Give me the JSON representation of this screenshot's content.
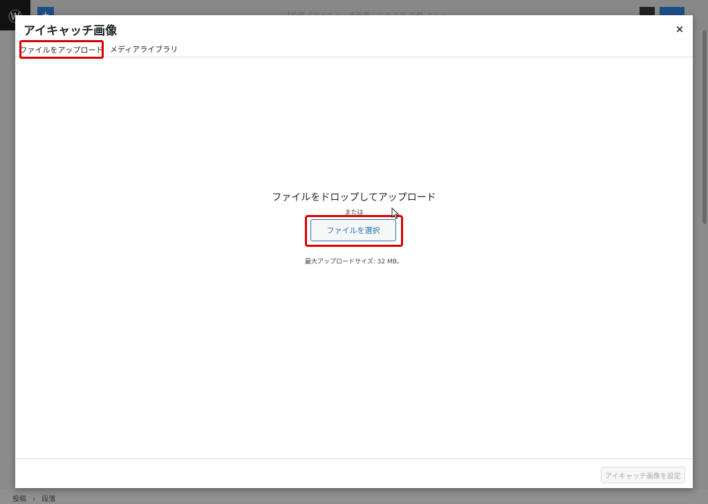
{
  "background": {
    "post_title": "【投稿「アイキャッチ画像」このス向 投稿 エトト",
    "breadcrumb": [
      "投稿",
      "段落"
    ],
    "breadcrumb_separator": "›"
  },
  "modal": {
    "title": "アイキャッチ画像",
    "close_label": "×",
    "tabs": [
      {
        "label": "ファイルをアップロード",
        "active": true
      },
      {
        "label": "メディアライブラリ",
        "active": false
      }
    ],
    "upload": {
      "drop_text": "ファイルをドロップしてアップロード",
      "or_text": "または",
      "select_button": "ファイルを選択",
      "max_size": "最大アップロードサイズ: 32 MB。"
    },
    "footer": {
      "set_button": "アイキャッチ画像を設定"
    }
  },
  "colors": {
    "highlight": "#d90000",
    "accent": "#2271b1"
  }
}
